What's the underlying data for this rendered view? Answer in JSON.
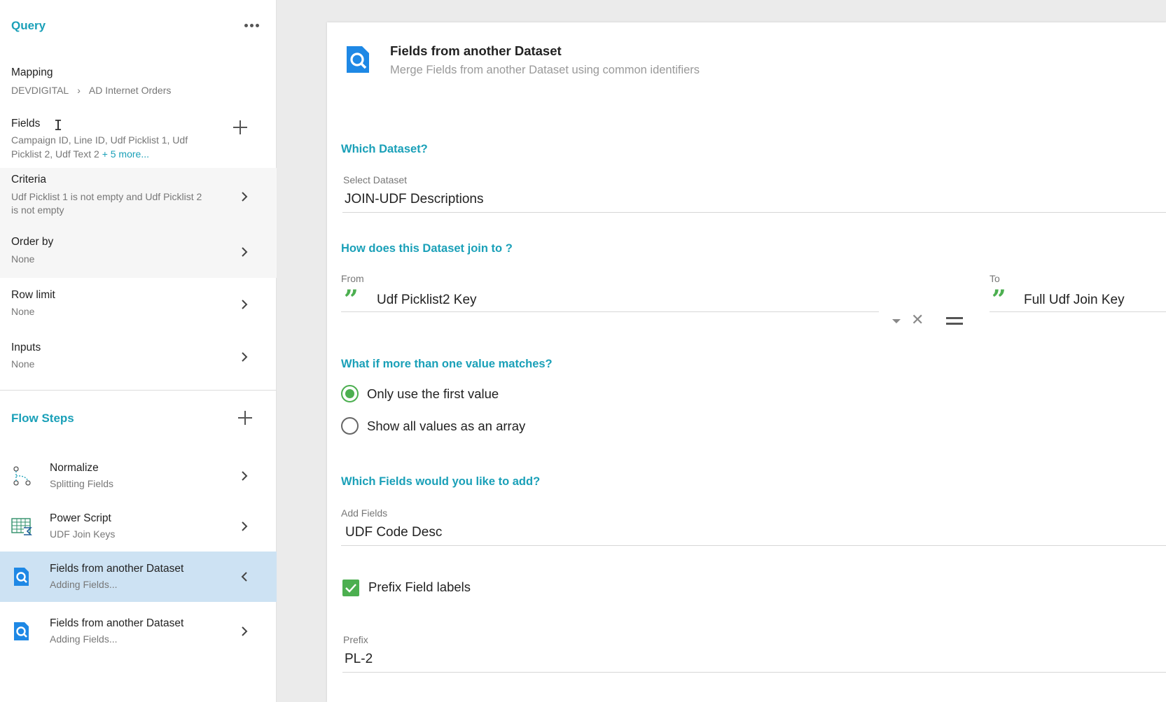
{
  "colors": {
    "accent": "#1aa0b8",
    "green": "#4caf50",
    "active_row": "#cde2f3"
  },
  "sidebar": {
    "title": "Query",
    "more_icon": "more-horizontal-icon",
    "mapping": {
      "label": "Mapping",
      "source": "DEVDIGITAL",
      "target": "AD Internet Orders"
    },
    "fields": {
      "label": "Fields",
      "line1": "Campaign ID,  Line ID,  Udf Picklist 1,  Udf",
      "line2": "Picklist 2,  Udf Text 2 ",
      "more_link": "+ 5 more..."
    },
    "criteria": {
      "label": "Criteria",
      "line1": "Udf Picklist 1 is not empty and Udf Picklist 2",
      "line2": "is not empty"
    },
    "order_by": {
      "label": "Order by",
      "value": "None"
    },
    "row_limit": {
      "label": "Row limit",
      "value": "None"
    },
    "inputs": {
      "label": "Inputs",
      "value": "None"
    },
    "flow_steps_title": "Flow Steps",
    "steps": [
      {
        "title": "Normalize",
        "subtitle": "Splitting Fields",
        "icon": "normalize-icon"
      },
      {
        "title": "Power Script",
        "subtitle": "UDF Join Keys",
        "icon": "power-script-icon"
      },
      {
        "title": "Fields from another Dataset",
        "subtitle": "Adding Fields...",
        "icon": "dataset-search-icon",
        "active": true
      },
      {
        "title": "Fields from another Dataset",
        "subtitle": "Adding Fields...",
        "icon": "dataset-search-icon"
      }
    ]
  },
  "panel": {
    "title": "Fields from another Dataset",
    "subtitle": "Merge Fields from another Dataset using common identifiers",
    "which_dataset": "Which Dataset?",
    "select_dataset_label": "Select Dataset",
    "select_dataset_value": "JOIN-UDF Descriptions",
    "join_question": "How does this Dataset join to ?",
    "from_label": "From",
    "from_value": "Udf Picklist2 Key",
    "to_label": "To",
    "to_value": "Full Udf Join Key",
    "matches_question": "What if more than one value matches?",
    "option_first": "Only use the first value",
    "option_array": "Show all values as an array",
    "fields_question": "Which Fields would you like to add?",
    "add_fields_label": "Add Fields",
    "add_fields_value": "UDF Code Desc",
    "prefix_checkbox_label": "Prefix Field labels",
    "prefix_label": "Prefix",
    "prefix_value": "PL-2"
  }
}
